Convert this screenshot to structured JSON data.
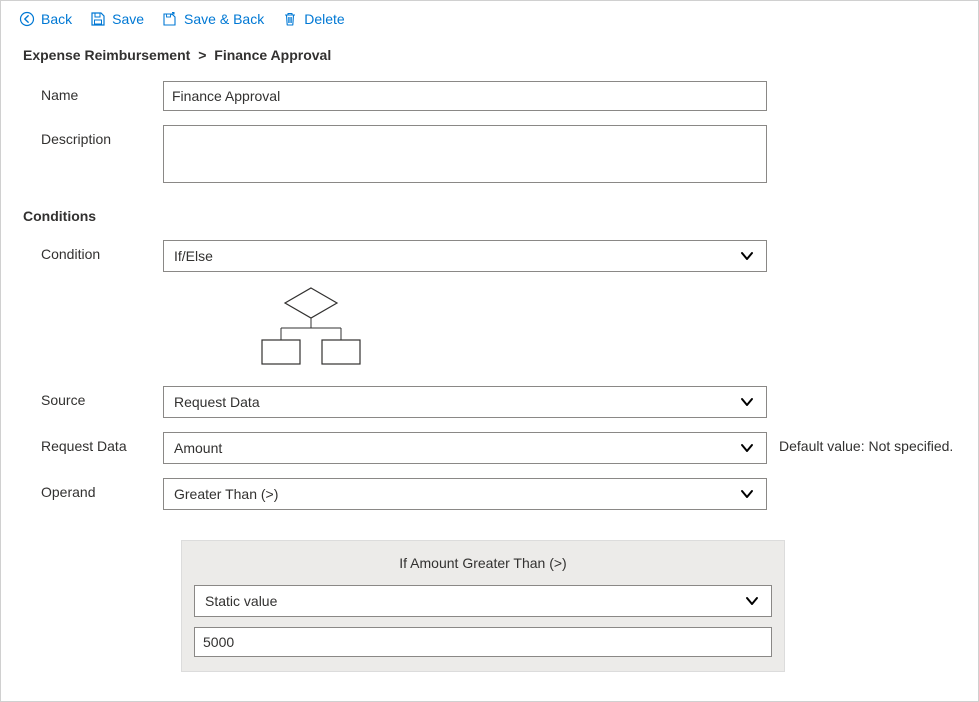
{
  "toolbar": {
    "back": "Back",
    "save": "Save",
    "save_back": "Save & Back",
    "delete": "Delete"
  },
  "breadcrumb": {
    "root": "Expense Reimbursement",
    "sep": ">",
    "current": "Finance Approval"
  },
  "labels": {
    "name": "Name",
    "description": "Description",
    "conditions": "Conditions",
    "condition": "Condition",
    "source": "Source",
    "request_data": "Request Data",
    "operand": "Operand"
  },
  "fields": {
    "name_value": "Finance Approval",
    "description_value": "",
    "condition_value": "If/Else",
    "source_value": "Request Data",
    "request_data_value": "Amount",
    "operand_value": "Greater Than (>)"
  },
  "hints": {
    "default_value": "Default value: Not specified."
  },
  "panel": {
    "title": "If Amount Greater Than (>)",
    "value_type": "Static value",
    "value": "5000"
  }
}
